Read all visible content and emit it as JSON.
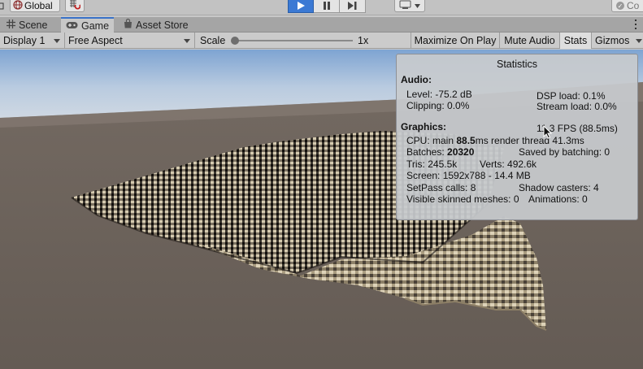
{
  "toolbar": {
    "pivot_rotation_label": "Global",
    "collab_label": "Co",
    "colors": {
      "play_active": "#3b79d4",
      "tab_active_indicator": "#3a72c8"
    }
  },
  "tabs": [
    {
      "label": "Scene",
      "icon": "grid-icon"
    },
    {
      "label": "Game",
      "icon": "gamepad-icon"
    },
    {
      "label": "Asset Store",
      "icon": "store-bag-icon"
    }
  ],
  "game_toolbar": {
    "display": "Display 1",
    "aspect": "Free Aspect",
    "scale_label": "Scale",
    "scale_value": "1x",
    "scale_slider_fraction": 0,
    "maximize_on_play": "Maximize On Play",
    "mute_audio": "Mute Audio",
    "stats": "Stats",
    "gizmos": "Gizmos"
  },
  "statistics": {
    "title": "Statistics",
    "audio": {
      "heading": "Audio:",
      "level": "Level: -75.2 dB",
      "clipping": "Clipping: 0.0%",
      "dsp_load": "DSP load: 0.1%",
      "stream_load": "Stream load: 0.0%"
    },
    "graphics": {
      "heading": "Graphics:",
      "fps": "11.3 FPS (88.5ms)",
      "cpu_prefix": "CPU: main ",
      "cpu_main": "88.5",
      "cpu_suffix": "ms  render thread 41.3ms",
      "batches_label": "Batches: ",
      "batches_value": "20320",
      "saved_by_batching": "Saved by batching: 0",
      "tris": "Tris: 245.5k",
      "verts": "Verts: 492.6k",
      "screen": "Screen: 1592x788 - 14.4 MB",
      "setpass": "SetPass calls: 8",
      "shadow_casters": "Shadow casters: 4",
      "skinned": "Visible skinned meshes: 0",
      "animations": "Animations: 0"
    }
  },
  "scene_colors": {
    "sky_top": "#7ea4d2",
    "sky_horizon": "#c4d2e2",
    "ground": "#6b625b",
    "cube_light": "#cfc3a6",
    "cube_dark": "#1f1c18"
  }
}
